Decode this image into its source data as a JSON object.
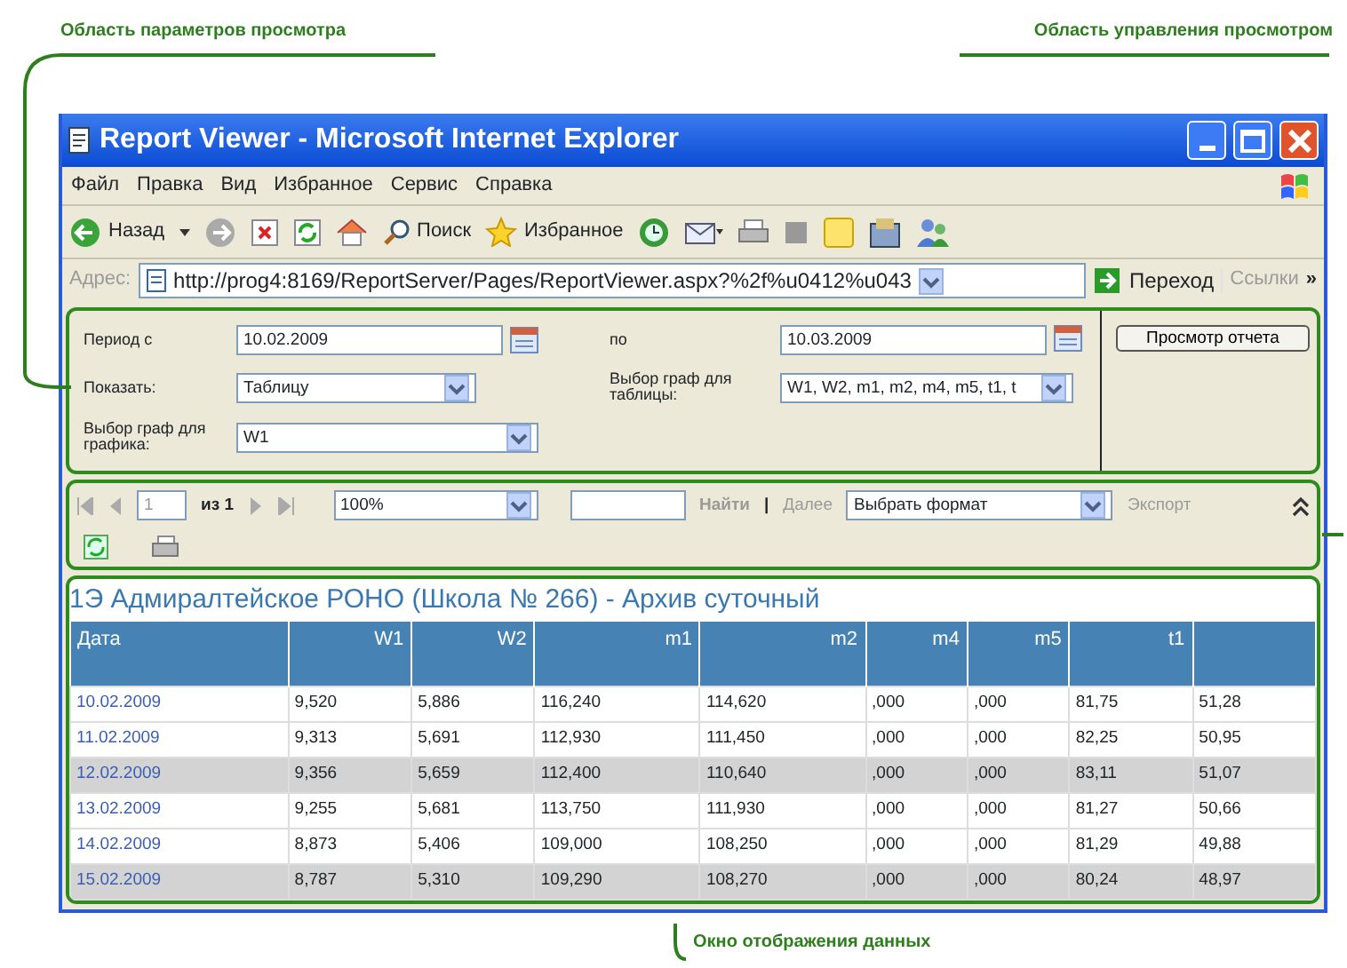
{
  "callouts": [
    {
      "text": "Область параметров просмотра"
    },
    {
      "text": "Область управления просмотром"
    },
    {
      "text": "Окно отображения данных"
    }
  ],
  "window": {
    "title": "Report Viewer - Microsoft Internet Explorer"
  },
  "menu": [
    "Файл",
    "Правка",
    "Вид",
    "Избранное",
    "Сервис",
    "Справка"
  ],
  "toolbar": {
    "back": "Назад",
    "search": "Поиск",
    "favorites": "Избранное"
  },
  "address": {
    "label": "Адрес:",
    "url": "http://prog4:8169/ReportServer/Pages/ReportViewer.aspx?%2f%u0412%u043",
    "go": "Переход",
    "links": "Ссылки",
    "more": "»"
  },
  "parameters": {
    "period_from": {
      "label": "Период с",
      "value": "10.02.2009"
    },
    "period_to": {
      "label": "по",
      "value": "10.03.2009"
    },
    "show": {
      "label": "Показать:",
      "value": "Таблицу"
    },
    "table_columns": {
      "label": "Выбор граф для таблицы:",
      "value": "W1, W2, m1, m2, m4, m5, t1, t"
    },
    "chart_columns": {
      "label": "Выбор граф для графика:",
      "value": "W1"
    },
    "view_button": "Просмотр отчета"
  },
  "report_toolbar": {
    "page": "1",
    "page_of": "из 1",
    "zoom": "100%",
    "find": "Найти",
    "separator": "|",
    "next": "Далее",
    "format": "Выбрать формат",
    "export": "Экспорт"
  },
  "report": {
    "title": "1Э Адмиралтейское РОНО (Школа № 266) - Архив суточный",
    "columns": [
      "Дата",
      "W1",
      "W2",
      "m1",
      "m2",
      "m4",
      "m5",
      "t1"
    ],
    "rows": [
      {
        "highlighted": false,
        "cells": [
          "10.02.2009",
          "9,520",
          "5,886",
          "116,240",
          "114,620",
          ",000",
          ",000",
          "81,75",
          "51,28"
        ]
      },
      {
        "highlighted": false,
        "cells": [
          "11.02.2009",
          "9,313",
          "5,691",
          "112,930",
          "111,450",
          ",000",
          ",000",
          "82,25",
          "50,95"
        ]
      },
      {
        "highlighted": true,
        "cells": [
          "12.02.2009",
          "9,356",
          "5,659",
          "112,400",
          "110,640",
          ",000",
          ",000",
          "83,11",
          "51,07"
        ]
      },
      {
        "highlighted": false,
        "cells": [
          "13.02.2009",
          "9,255",
          "5,681",
          "113,750",
          "111,930",
          ",000",
          ",000",
          "81,27",
          "50,66"
        ]
      },
      {
        "highlighted": false,
        "cells": [
          "14.02.2009",
          "8,873",
          "5,406",
          "109,000",
          "108,250",
          ",000",
          ",000",
          "81,29",
          "49,88"
        ]
      },
      {
        "highlighted": true,
        "cells": [
          "15.02.2009",
          "8,787",
          "5,310",
          "109,290",
          "108,270",
          ",000",
          ",000",
          "80,24",
          "48,97"
        ]
      }
    ]
  }
}
